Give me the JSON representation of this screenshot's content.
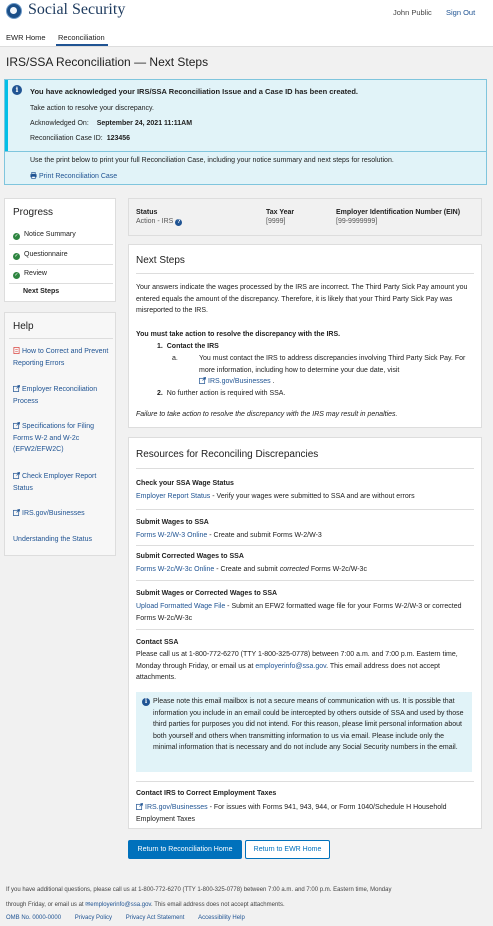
{
  "header": {
    "brand": "Social Security",
    "user": "John Public",
    "sign_out": "Sign Out"
  },
  "nav": {
    "home": "EWR Home",
    "reconciliation": "Reconciliation"
  },
  "page_title": "IRS/SSA Reconciliation — Next Steps",
  "alert": {
    "heading": "You have acknowledged your IRS/SSA Reconciliation Issue and a Case ID has been created.",
    "action_text": "Take action to resolve your discrepancy.",
    "ack_label": "Acknowledged On:",
    "ack_value": "September 24, 2021 11:11AM",
    "case_label": "Reconciliation Case ID:",
    "case_value": "123456",
    "print_text": "Use the print below to print your full Reconciliation Case, including your notice summary and next steps for resolution.",
    "print_link": "Print Reconciliation Case"
  },
  "progress": {
    "title": "Progress",
    "steps": [
      "Notice Summary",
      "Questionnaire",
      "Review"
    ],
    "current": "Next Steps"
  },
  "help": {
    "title": "Help",
    "links": [
      "How to Correct and Prevent Reporting Errors",
      "Employer Reconciliation Process",
      "Specifications for Filing Forms W-2 and W-2c (EFW2/EFW2C)",
      "Check Employer Report Status",
      "IRS.gov/Businesses",
      "Understanding the Status"
    ]
  },
  "status_card": {
    "status_label": "Status",
    "status_value": "Action - IRS",
    "tax_year_label": "Tax Year",
    "tax_year_value": "[9999]",
    "ein_label": "Employer Identification Number (EIN)",
    "ein_value": "[99-9999999]"
  },
  "next_steps": {
    "title": "Next Steps",
    "intro": "Your answers indicate the wages processed by the IRS are incorrect. The Third Party Sick Pay amount you entered equals the amount of the discrepancy. Therefore, it is likely that your Third Party Sick Pay was misreported to the IRS.",
    "must_act": "You must take action to resolve the discrepancy with the IRS.",
    "step1": "Contact the IRS",
    "step1a": "You must contact the IRS to address discrepancies involving Third Party Sick Pay. For more information, including how to determine your due date, visit",
    "step1a_link": "IRS.gov/Businesses",
    "step2": "No further action is required with SSA.",
    "warning": "Failure to take action to resolve the discrepancy with the IRS may result in penalties."
  },
  "resources": {
    "title": "Resources for Reconciling Discrepancies",
    "items": [
      {
        "heading": "Check your SSA Wage Status",
        "link": "Employer Report Status",
        "text": " - Verify your wages were submitted to SSA and are without errors"
      },
      {
        "heading": "Submit Wages to SSA",
        "link": "Forms  W-2/W-3 Online",
        "text": " - Create and submit Forms W-2/W-3"
      },
      {
        "heading": "Submit Corrected Wages to  SSA",
        "link": "Forms  W-2c/W-3c Online",
        "text_pre": " - Create and submit ",
        "text_italic": "corrected",
        "text_post": " Forms W-2c/W-3c"
      },
      {
        "heading": "Submit Wages or Corrected Wages to  SSA",
        "link": "Upload Formatted Wage File",
        "text": " - Submit an EFW2 formatted wage file for your Forms W-2/W-3 or corrected Forms W-2c/W-3c"
      }
    ],
    "contact_heading": "Contact SSA",
    "contact_pre": "Please call us at 1-800-772-6270 (TTY 1-800-325-0778) between 7:00 a.m. and 7:00 p.m. Eastern time, Monday through Friday, or email us at ",
    "contact_email": "employerinfo@ssa.gov",
    "contact_post": ". This email address does not accept attachments.",
    "note": "Please note this email mailbox is not a secure means of communication with us. It is possible that information you include in an email could be intercepted by others outside of SSA and used by those third parties for purposes you did not intend. For this reason, please limit personal information about both yourself and others when transmitting information to us via email.  Please include only the minimal information that is necessary and do not include any Social Security numbers in the email.",
    "irs_heading": "Contact IRS to Correct Employment Taxes",
    "irs_link": "IRS.gov/Businesses",
    "irs_text": " - For issues with Forms 941, 943, 944, or Form 1040/Schedule H Household Employment Taxes"
  },
  "buttons": {
    "primary": "Return to Reconciliation Home",
    "secondary": "Return to EWR Home"
  },
  "footer": {
    "line1": "If you have additional questions, please call us at 1-800-772-6270 (TTY 1-800-325-0778) between 7:00 a.m. and 7:00 p.m. Eastern time, Monday",
    "line2_pre": "through Friday, or email us at ",
    "line2_email": "employerinfo@ssa.gov",
    "line2_post": ". This email address does not accept attachments.",
    "links": [
      "OMB No. 0000-0000",
      "Privacy Policy",
      "Privacy Act Statement",
      "Accessibility Help"
    ]
  },
  "colors": {
    "primary": "#0071bc",
    "link": "#205493",
    "alert_bg": "#e1f3f8",
    "success": "#2e8540"
  }
}
